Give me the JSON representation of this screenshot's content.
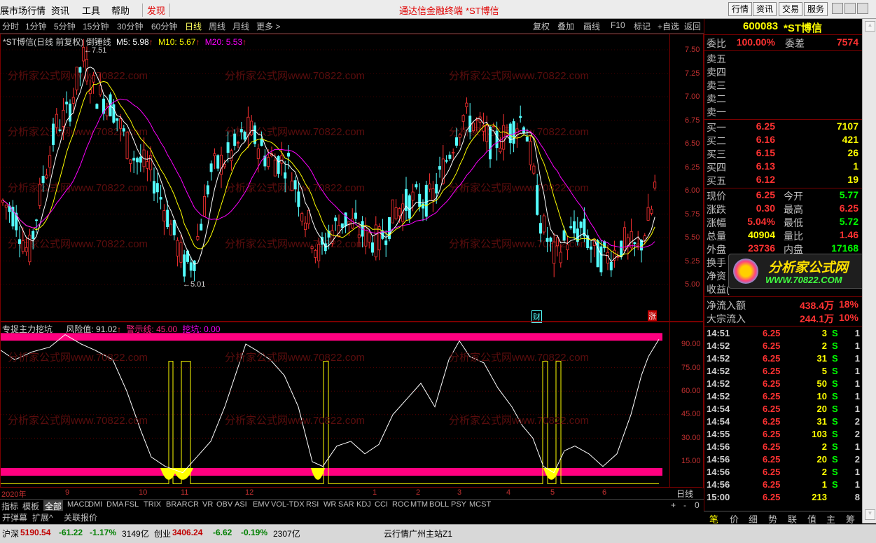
{
  "menu": {
    "items": [
      "展市场行情",
      "资讯",
      "工具",
      "帮助"
    ],
    "discover": "发现",
    "title": "通达信金融终端",
    "stock_title": "*ST博信",
    "right_buttons": [
      "行情",
      "资讯",
      "交易",
      "服务"
    ]
  },
  "toolbar": {
    "periods": [
      "分时",
      "1分钟",
      "5分钟",
      "15分钟",
      "30分钟",
      "60分钟",
      "日线",
      "周线",
      "月线",
      "更多 >"
    ],
    "active_period": "日线",
    "actions": [
      "复权",
      "叠加",
      "画线",
      "F10",
      "标记",
      "+自选",
      "返回"
    ]
  },
  "main_chart": {
    "title": "*ST博信(日线 前复权) 倒锤线",
    "ma5": "M5: 5.98",
    "ma10": "M10: 5.67",
    "ma20": "M20: 5.53",
    "high_label": "7.51",
    "low_label": "5.01",
    "badge_cai": "财",
    "badge_zhang": "涨",
    "price_ticks": [
      "7.50",
      "7.25",
      "7.00",
      "6.75",
      "6.50",
      "6.25",
      "6.00",
      "5.75",
      "5.50",
      "5.25",
      "5.00"
    ],
    "watermarks": [
      "www.70822.com",
      "分析家公式网",
      "分析家公式网www.70822.com"
    ]
  },
  "indicator": {
    "title": "专捉主力挖坑",
    "risk": "风险值: 91.02",
    "warn": "警示线: 45.00",
    "pit": "挖坑: 0.00",
    "ticks": [
      "90.00",
      "75.00",
      "60.00",
      "45.00",
      "30.00",
      "15.00"
    ]
  },
  "x_axis": {
    "labels": [
      "2020年",
      "9",
      "10",
      "11",
      "12",
      "1",
      "2",
      "3",
      "4",
      "5",
      "6"
    ],
    "period": "日线"
  },
  "indicator_tabs": [
    "指标",
    "模板",
    "全部",
    "MACD",
    "DMI",
    "DMA",
    "FSL",
    "TRIX",
    "BRAR",
    "CR",
    "VR",
    "OBV",
    "ASI",
    "EMV",
    "VOL-TDX",
    "RSI",
    "WR",
    "SAR",
    "KDJ",
    "CCI",
    "ROC",
    "MTM",
    "BOLL",
    "PSY",
    "MCST"
  ],
  "func_tabs": [
    "开弹幕",
    "扩展^",
    "关联报价"
  ],
  "quote": {
    "code": "600083",
    "name": "*ST博信",
    "weibi_label": "委比",
    "weibi": "100.00%",
    "weicha_label": "委差",
    "weicha": "7574",
    "sells": [
      "卖五",
      "卖四",
      "卖三",
      "卖二",
      "卖一"
    ],
    "buys": [
      {
        "label": "买一",
        "price": "6.25",
        "vol": "7107"
      },
      {
        "label": "买二",
        "price": "6.16",
        "vol": "421"
      },
      {
        "label": "买三",
        "price": "6.15",
        "vol": "26"
      },
      {
        "label": "买四",
        "price": "6.13",
        "vol": "1"
      },
      {
        "label": "买五",
        "price": "6.12",
        "vol": "19"
      }
    ],
    "stats": [
      {
        "l1": "现价",
        "v1": "6.25",
        "l2": "今开",
        "v2": "5.77"
      },
      {
        "l1": "涨跌",
        "v1": "0.30",
        "l2": "最高",
        "v2": "6.25"
      },
      {
        "l1": "涨幅",
        "v1": "5.04%",
        "l2": "最低",
        "v2": "5.72"
      },
      {
        "l1": "总量",
        "v1": "40904",
        "l2": "量比",
        "v2": "1.46"
      },
      {
        "l1": "外盘",
        "v1": "23736",
        "l2": "内盘",
        "v2": "17168"
      }
    ],
    "partial_labels": [
      "换手",
      "净资",
      "收益("
    ],
    "flows": [
      {
        "label": "净流入额",
        "value": "438.4万",
        "pct": "18%"
      },
      {
        "label": "大宗流入",
        "value": "244.1万",
        "pct": "10%"
      }
    ],
    "ticks": [
      {
        "t": "14:51",
        "p": "6.25",
        "v": "3",
        "d": "S",
        "n": "1"
      },
      {
        "t": "14:52",
        "p": "6.25",
        "v": "2",
        "d": "S",
        "n": "1"
      },
      {
        "t": "14:52",
        "p": "6.25",
        "v": "31",
        "d": "S",
        "n": "1"
      },
      {
        "t": "14:52",
        "p": "6.25",
        "v": "5",
        "d": "S",
        "n": "1"
      },
      {
        "t": "14:52",
        "p": "6.25",
        "v": "50",
        "d": "S",
        "n": "1"
      },
      {
        "t": "14:52",
        "p": "6.25",
        "v": "10",
        "d": "S",
        "n": "1"
      },
      {
        "t": "14:54",
        "p": "6.25",
        "v": "20",
        "d": "S",
        "n": "1"
      },
      {
        "t": "14:54",
        "p": "6.25",
        "v": "31",
        "d": "S",
        "n": "2"
      },
      {
        "t": "14:55",
        "p": "6.25",
        "v": "103",
        "d": "S",
        "n": "2"
      },
      {
        "t": "14:56",
        "p": "6.25",
        "v": "2",
        "d": "S",
        "n": "1"
      },
      {
        "t": "14:56",
        "p": "6.25",
        "v": "20",
        "d": "S",
        "n": "2"
      },
      {
        "t": "14:56",
        "p": "6.25",
        "v": "2",
        "d": "S",
        "n": "1"
      },
      {
        "t": "14:56",
        "p": "6.25",
        "v": "1",
        "d": "S",
        "n": "1"
      },
      {
        "t": "15:00",
        "p": "6.25",
        "v": "213",
        "d": "",
        "n": "8"
      }
    ],
    "tabs": [
      "笔",
      "价",
      "细",
      "势",
      "联",
      "值",
      "主",
      "筹"
    ]
  },
  "logo": {
    "text1": "分析家公式网",
    "text2": "WWW.70822.COM"
  },
  "status": {
    "sh_label": "沪深",
    "sh_val": "5190.54",
    "sh_chg": "-61.22",
    "sh_pct": "-1.17%",
    "sh_amt": "3149亿",
    "cy_label": "创业",
    "cy_val": "3406.24",
    "cy_chg": "-6.62",
    "cy_pct": "-0.19%",
    "cy_amt": "2307亿",
    "server": "云行情广州主站Z1"
  },
  "colors": {
    "up": "#ff3232",
    "down": "#54ffff",
    "ma5": "#ffffff",
    "ma10": "#ffff00",
    "ma20": "#ff00ff",
    "band": "#ff0080",
    "value": "#ffff00",
    "green": "#00ff00"
  }
}
